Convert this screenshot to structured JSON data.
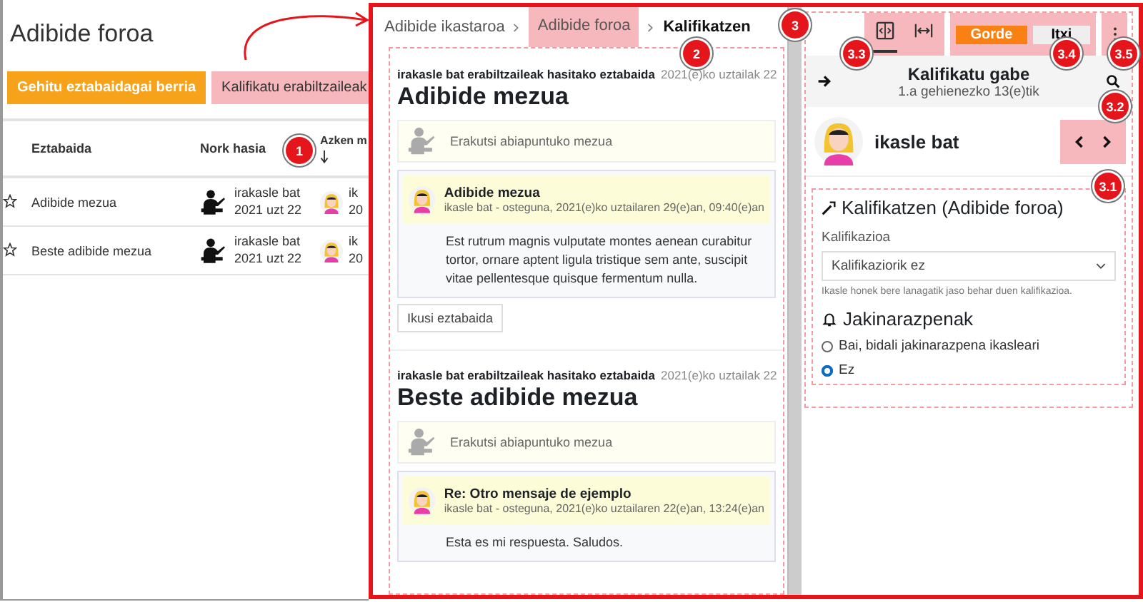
{
  "forum_page": {
    "title": "Adibide foroa",
    "buttons": [
      {
        "label": "Gehitu eztabaidagai berria",
        "kind": "primary",
        "highlighted": false
      },
      {
        "label": "Kalifikatu erabiltzaileak",
        "kind": "secondary",
        "highlighted": true
      }
    ],
    "table": {
      "columns": [
        "Eztabaida",
        "Nork hasia",
        "Azken m"
      ],
      "rows": [
        {
          "starred": false,
          "discussion": "Adibide mezua",
          "started_by": "irakasle bat",
          "started_date": "2021 uzt 22",
          "column_3_name": "ik",
          "column_3_date": "20"
        },
        {
          "starred": false,
          "discussion": "Beste adibide mezua",
          "started_by": "irakasle bat",
          "started_date": "2021 uzt 22",
          "column_3_name": "ik",
          "column_3_date": "20"
        }
      ]
    }
  },
  "grader": {
    "breadcrumb": [
      {
        "label": "Adibide ikastaroa",
        "highlighted": false,
        "current": false
      },
      {
        "label": "Adibide foroa",
        "highlighted": true,
        "current": false
      },
      {
        "label": "Kalifikatzen",
        "highlighted": false,
        "current": true
      }
    ],
    "discussions": [
      {
        "started_by": "irakasle bat erabiltzaileak hasitako eztabaida",
        "date": "2021(e)ko uztailak 22",
        "title": "Adibide mezua",
        "parent_link": "Erakutsi abiapuntuko mezua",
        "post": {
          "subject": "Adibide mezua",
          "byline": "ikasle bat - osteguna, 2021(e)ko uztailaren 29(e)an, 09:40(e)an",
          "body": "Est rutrum magnis vulputate montes aenean curabitur tortor, ornare aptent ligula tristique sem ante, suscipit vitae pellentesque quisque fermentum nulla."
        },
        "button": "Ikusi eztabaida"
      },
      {
        "started_by": "irakasle bat erabiltzaileak hasitako eztabaida",
        "date": "2021(e)ko uztailak 22",
        "title": "Beste adibide mezua",
        "parent_link": "Erakutsi abiapuntuko mezua",
        "post": {
          "subject": "Re: Otro mensaje de ejemplo",
          "byline": "ikasle bat - osteguna, 2021(e)ko uztailaren 22(e)an, 13:24(e)an",
          "body": "Esta es mi respuesta. Saludos."
        }
      }
    ],
    "toolbar": {
      "view_buttons": [
        {
          "kind": "panel",
          "selected": true
        },
        {
          "kind": "expand",
          "selected": false
        }
      ],
      "save": "Gorde",
      "close": "Itxi"
    },
    "user_selector": {
      "filter": "Kalifikatu gabe",
      "count": "1.a gehienezko 13(e)tik"
    },
    "student": {
      "name": "ikasle bat"
    },
    "grade_form": {
      "heading": "Kalifikatzen (Adibide foroa)",
      "grade_label": "Kalifikazioa",
      "grade_value": "Kalifikaziorik ez",
      "help": "Ikasle honek bere lanagatik jaso behar duen kalifikazioa.",
      "notify_heading": "Jakinarazpenak",
      "options": [
        {
          "label": "Bai, bidali jakinarazpena ikasleari",
          "selected": false
        },
        {
          "label": "Ez",
          "selected": true
        }
      ]
    }
  },
  "annotations": [
    {
      "label": "1"
    },
    {
      "label": "2"
    },
    {
      "label": "3"
    },
    {
      "label": "3.3"
    },
    {
      "label": "3.4"
    },
    {
      "label": "3.5"
    },
    {
      "label": "3.2"
    },
    {
      "label": "3.1"
    }
  ]
}
